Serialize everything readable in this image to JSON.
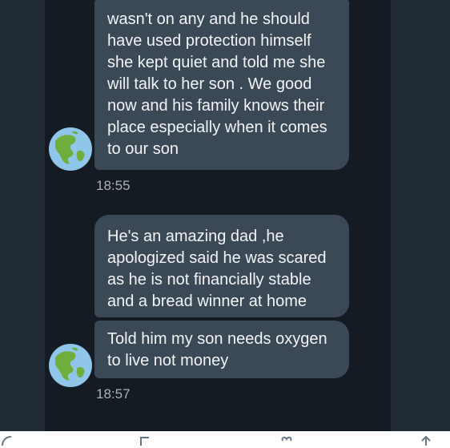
{
  "messages": [
    {
      "text": "wasn't on any and he should have used protection himself she kept quiet and told me she will talk to her son . We good now and his family knows their place especially when it comes to our son"
    },
    {
      "text": "He's an amazing dad ,he apologized said he was scared as he is not financially stable and a bread winner at home"
    },
    {
      "text": "Told him my son needs oxygen to live not money"
    }
  ],
  "timestamps": [
    "18:55",
    "18:57"
  ],
  "avatar_icon": "globe-americas-icon",
  "colors": {
    "background": "#202b36",
    "chat_panel": "#141b22",
    "bubble": "#3b4856",
    "bubble_text": "#f2f4f6",
    "timestamp": "#a8b2bc"
  }
}
